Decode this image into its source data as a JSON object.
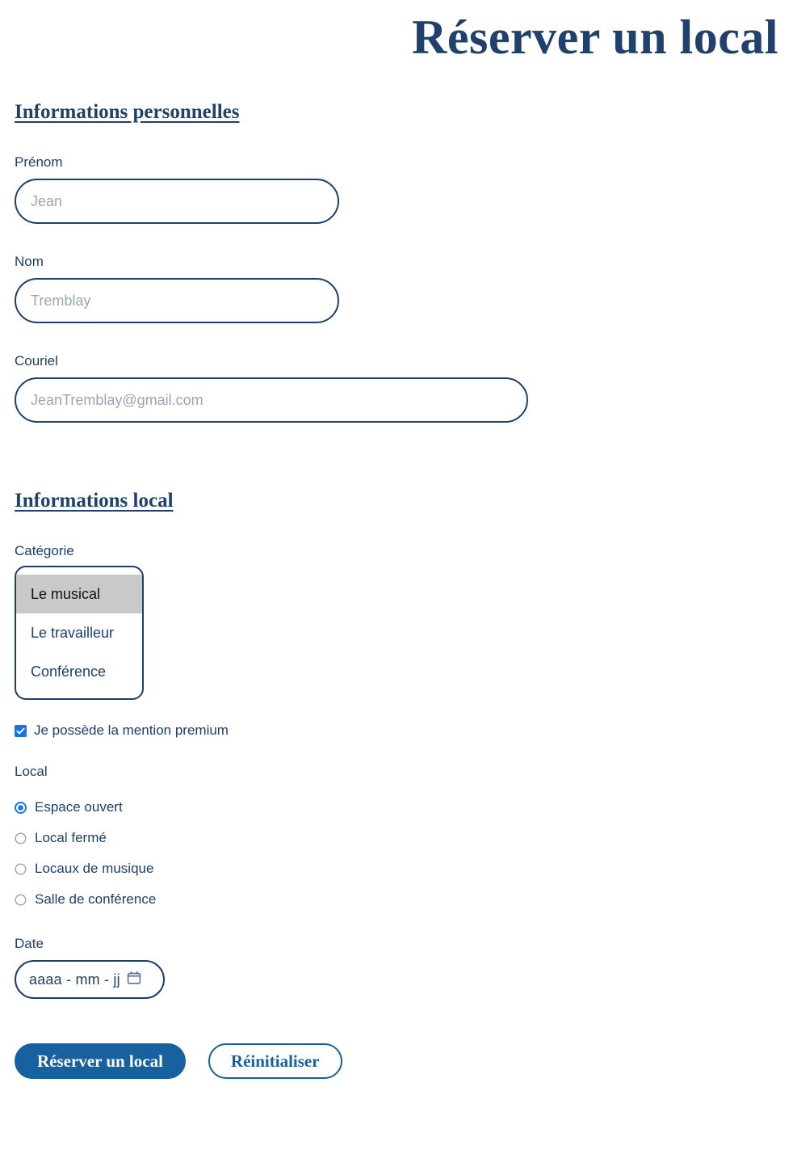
{
  "page": {
    "title": "Réserver un local"
  },
  "sections": {
    "personal": {
      "heading": "Informations personnelles",
      "fields": {
        "firstname": {
          "label": "Prénom",
          "value": "",
          "placeholder": "Jean"
        },
        "lastname": {
          "label": "Nom",
          "value": "",
          "placeholder": "Tremblay"
        },
        "email": {
          "label": "Couriel",
          "value": "",
          "placeholder": "JeanTremblay@gmail.com"
        }
      }
    },
    "local": {
      "heading": "Informations local",
      "category": {
        "label": "Catégorie",
        "options": [
          "Le musical",
          "Le travailleur",
          "Conférence"
        ],
        "selected": "Le musical"
      },
      "premium": {
        "label": "Je possède la mention premium",
        "checked": true,
        "icon": "checkbox-checked-icon"
      },
      "room": {
        "label": "Local",
        "options": [
          "Espace ouvert",
          "Local fermé",
          "Locaux de musique",
          "Salle de conférence"
        ],
        "selected": "Espace ouvert"
      },
      "date": {
        "label": "Date",
        "value": "",
        "placeholder": "aaaa - mm - jj",
        "icon": "calendar-icon"
      }
    }
  },
  "actions": {
    "submit": "Réserver un local",
    "reset": "Réinitialiser"
  },
  "colors": {
    "title_navy": "#20416b",
    "label_navy": "#1e3f68",
    "border_navy": "#1e3f68",
    "button_blue": "#17619e",
    "control_blue": "#1a73e8",
    "placeholder_gray": "#9aa6b4",
    "option_highlight": "#c9c9c9",
    "background": "#ffffff"
  }
}
